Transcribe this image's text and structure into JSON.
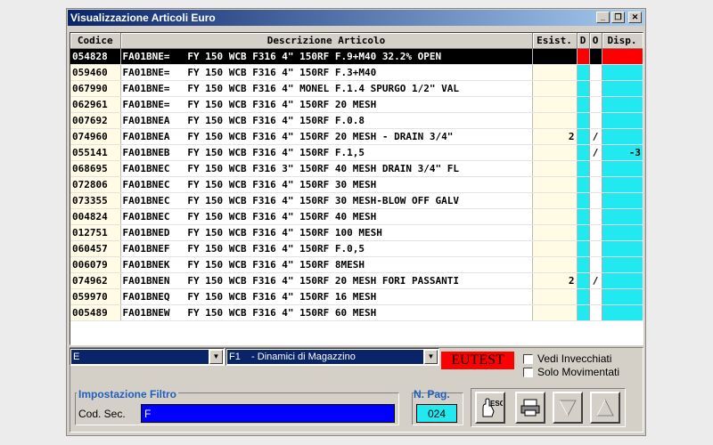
{
  "window": {
    "title": "Visualizzazione Articoli Euro"
  },
  "table": {
    "headers": [
      "Codice",
      "Descrizione Articolo",
      "Esist.",
      "D",
      "O",
      "Disp."
    ],
    "rows": [
      {
        "code": "054828",
        "desc": "FA01BNE=   FY 150 WCB F316 4\" 150RF F.9+M40 32.2% OPEN",
        "esist": "",
        "o": "",
        "disp": ""
      },
      {
        "code": "059460",
        "desc": "FA01BNE=   FY 150 WCB F316 4\" 150RF F.3+M40",
        "esist": "",
        "o": "",
        "disp": ""
      },
      {
        "code": "067990",
        "desc": "FA01BNE=   FY 150 WCB F316 4\" MONEL F.1.4 SPURGO 1/2\" VAL",
        "esist": "",
        "o": "",
        "disp": ""
      },
      {
        "code": "062961",
        "desc": "FA01BNE=   FY 150 WCB F316 4\" 150RF 20 MESH",
        "esist": "",
        "o": "",
        "disp": ""
      },
      {
        "code": "007692",
        "desc": "FA01BNEA   FY 150 WCB F316 4\" 150RF F.0.8",
        "esist": "",
        "o": "",
        "disp": ""
      },
      {
        "code": "074960",
        "desc": "FA01BNEA   FY 150 WCB F316 4\" 150RF 20 MESH - DRAIN 3/4\"",
        "esist": "2",
        "o": "/",
        "disp": ""
      },
      {
        "code": "055141",
        "desc": "FA01BNEB   FY 150 WCB F316 4\" 150RF F.1,5",
        "esist": "",
        "o": "/",
        "disp": "-3"
      },
      {
        "code": "068695",
        "desc": "FA01BNEC   FY 150 WCB F316 3\" 150RF 40 MESH DRAIN 3/4\" FL",
        "esist": "",
        "o": "",
        "disp": ""
      },
      {
        "code": "072806",
        "desc": "FA01BNEC   FY 150 WCB F316 4\" 150RF 30 MESH",
        "esist": "",
        "o": "",
        "disp": ""
      },
      {
        "code": "073355",
        "desc": "FA01BNEC   FY 150 WCB F316 4\" 150RF 30 MESH-BLOW OFF GALV",
        "esist": "",
        "o": "",
        "disp": ""
      },
      {
        "code": "004824",
        "desc": "FA01BNEC   FY 150 WCB F316 4\" 150RF 40 MESH",
        "esist": "",
        "o": "",
        "disp": ""
      },
      {
        "code": "012751",
        "desc": "FA01BNED   FY 150 WCB F316 4\" 150RF 100 MESH",
        "esist": "",
        "o": "",
        "disp": ""
      },
      {
        "code": "060457",
        "desc": "FA01BNEF   FY 150 WCB F316 4\" 150RF F.0,5",
        "esist": "",
        "o": "",
        "disp": ""
      },
      {
        "code": "006079",
        "desc": "FA01BNEK   FY 150 WCB F316 4\" 150RF 8MESH",
        "esist": "",
        "o": "",
        "disp": ""
      },
      {
        "code": "074962",
        "desc": "FA01BNEN   FY 150 WCB F316 4\" 150RF 20 MESH FORI PASSANTI",
        "esist": "2",
        "o": "/",
        "disp": ""
      },
      {
        "code": "059970",
        "desc": "FA01BNEQ   FY 150 WCB F316 4\" 150RF 16 MESH",
        "esist": "",
        "o": "",
        "disp": ""
      },
      {
        "code": "005489",
        "desc": "FA01BNEW   FY 150 WCB F316 4\" 150RF 60 MESH",
        "esist": "",
        "o": "",
        "disp": ""
      }
    ]
  },
  "filters": {
    "combo1_value": "E",
    "combo2_value": "F1    - Dinamici di Magazzino",
    "badge": "EUTEST",
    "check1": "Vedi Invecchiati",
    "check2": "Solo Movimentati",
    "group_title": "Impostazione Filtro",
    "cod_sec_label": "Cod. Sec.",
    "cod_sec_value": "F",
    "npag_label": "N. Pag.",
    "npag_value": "024",
    "esc_label": "ESC"
  },
  "colors": {
    "cyan": "#22e8f0",
    "selected_red": "#ff0000",
    "blue_field": "#0000ff"
  },
  "icons": {
    "minimize": "minimize-icon",
    "restore": "restore-icon",
    "close": "close-icon",
    "esc": "esc-hand-icon",
    "print": "printer-icon",
    "down": "triangle-down-icon",
    "up": "triangle-up-icon"
  }
}
